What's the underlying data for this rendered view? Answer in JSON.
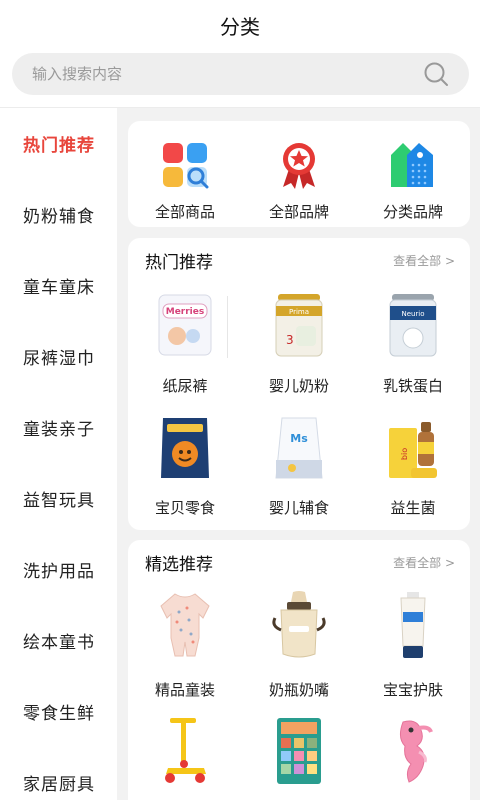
{
  "header": {
    "title": "分类"
  },
  "search": {
    "placeholder": "输入搜索内容"
  },
  "sidebar": {
    "items": [
      {
        "label": "热门推荐",
        "active": true
      },
      {
        "label": "奶粉辅食"
      },
      {
        "label": "童车童床"
      },
      {
        "label": "尿裤湿巾"
      },
      {
        "label": "童装亲子"
      },
      {
        "label": "益智玩具"
      },
      {
        "label": "洗护用品"
      },
      {
        "label": "绘本童书"
      },
      {
        "label": "零食生鲜"
      },
      {
        "label": "家居厨具"
      }
    ]
  },
  "quick": [
    {
      "label": "全部商品",
      "icon": "grid-apps-icon"
    },
    {
      "label": "全部品牌",
      "icon": "star-badge-icon"
    },
    {
      "label": "分类品牌",
      "icon": "tag-label-icon"
    }
  ],
  "hot": {
    "title": "热门推荐",
    "more": "查看全部 >",
    "items": [
      {
        "label": "纸尿裤",
        "icon": "diaper-pack-icon"
      },
      {
        "label": "婴儿奶粉",
        "icon": "milk-powder-can-icon"
      },
      {
        "label": "乳铁蛋白",
        "icon": "lactoferrin-can-icon"
      },
      {
        "label": "宝贝零食",
        "icon": "snack-bag-icon"
      },
      {
        "label": "婴儿辅食",
        "icon": "baby-food-pouch-icon"
      },
      {
        "label": "益生菌",
        "icon": "probiotic-box-icon"
      }
    ]
  },
  "picks": {
    "title": "精选推荐",
    "more": "查看全部 >",
    "items": [
      {
        "label": "精品童装",
        "icon": "baby-romper-icon"
      },
      {
        "label": "奶瓶奶嘴",
        "icon": "baby-bottle-icon"
      },
      {
        "label": "宝宝护肤",
        "icon": "cream-tube-icon"
      },
      {
        "label": "",
        "icon": "kick-scooter-icon"
      },
      {
        "label": "",
        "icon": "picture-book-set-icon"
      },
      {
        "label": "",
        "icon": "plush-seahorse-icon"
      }
    ]
  },
  "colors": {
    "accent": "#e8463c",
    "bg": "#f2f2f2"
  }
}
